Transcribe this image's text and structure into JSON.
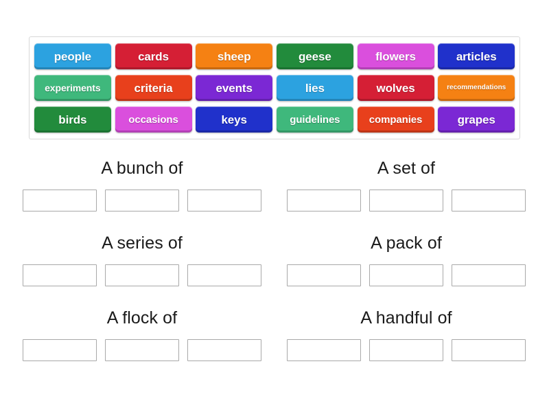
{
  "activity": {
    "type": "group-sort",
    "tray": {
      "rows": [
        [
          {
            "label": "people",
            "color": "#2ca2e0",
            "size": ""
          },
          {
            "label": "cards",
            "color": "#d51f35",
            "size": ""
          },
          {
            "label": "sheep",
            "color": "#f58113",
            "size": ""
          },
          {
            "label": "geese",
            "color": "#228b3c",
            "size": ""
          },
          {
            "label": "flowers",
            "color": "#da4fdd",
            "size": ""
          },
          {
            "label": "articles",
            "color": "#2031cb",
            "size": ""
          }
        ],
        [
          {
            "label": "experiments",
            "color": "#3fb87c",
            "size": "sz-14"
          },
          {
            "label": "criteria",
            "color": "#e8401c",
            "size": ""
          },
          {
            "label": "events",
            "color": "#7b28d4",
            "size": ""
          },
          {
            "label": "lies",
            "color": "#2ca2e0",
            "size": ""
          },
          {
            "label": "wolves",
            "color": "#d51f35",
            "size": ""
          },
          {
            "label": "recommendations",
            "color": "#f58113",
            "size": "sz-10"
          }
        ],
        [
          {
            "label": "birds",
            "color": "#228b3c",
            "size": ""
          },
          {
            "label": "occasions",
            "color": "#da4fdd",
            "size": "sz-15"
          },
          {
            "label": "keys",
            "color": "#2031cb",
            "size": ""
          },
          {
            "label": "guidelines",
            "color": "#3fb87c",
            "size": "sz-15"
          },
          {
            "label": "companies",
            "color": "#e8401c",
            "size": "sz-15"
          },
          {
            "label": "grapes",
            "color": "#7b28d4",
            "size": ""
          }
        ]
      ]
    },
    "groups": [
      {
        "title": "A bunch of",
        "slots": [
          "",
          "",
          ""
        ]
      },
      {
        "title": "A set of",
        "slots": [
          "",
          "",
          ""
        ]
      },
      {
        "title": "A series of",
        "slots": [
          "",
          "",
          ""
        ]
      },
      {
        "title": "A pack of",
        "slots": [
          "",
          "",
          ""
        ]
      },
      {
        "title": "A flock of",
        "slots": [
          "",
          "",
          ""
        ]
      },
      {
        "title": "A handful of",
        "slots": [
          "",
          "",
          ""
        ]
      }
    ]
  }
}
